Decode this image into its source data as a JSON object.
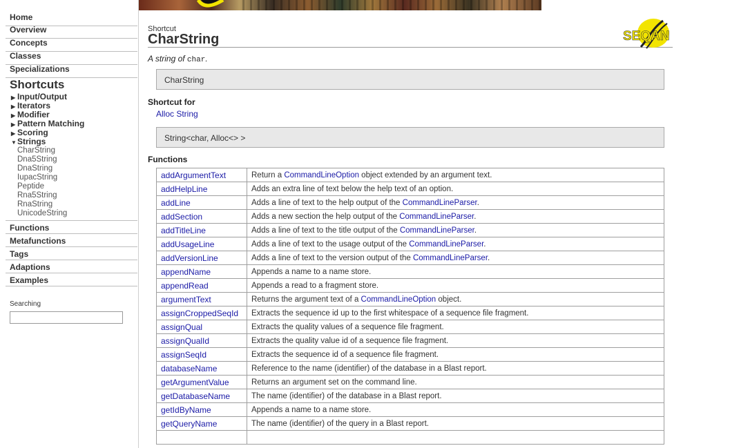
{
  "sidebar": {
    "nav": [
      "Home",
      "Overview",
      "Concepts",
      "Classes",
      "Specializations"
    ],
    "shortcuts_heading": "Shortcuts",
    "shortcut_groups": [
      {
        "label": "Input/Output",
        "expanded": false
      },
      {
        "label": "Iterators",
        "expanded": false
      },
      {
        "label": "Modifier",
        "expanded": false
      },
      {
        "label": "Pattern Matching",
        "expanded": false
      },
      {
        "label": "Scoring",
        "expanded": false
      },
      {
        "label": "Strings",
        "expanded": true
      }
    ],
    "string_items": [
      "CharString",
      "Dna5String",
      "DnaString",
      "IupacString",
      "Peptide",
      "Rna5String",
      "RnaString",
      "UnicodeString"
    ],
    "nav_after": [
      "Functions",
      "Metafunctions",
      "Tags",
      "Adaptions",
      "Examples"
    ],
    "search_label": "Searching",
    "search_value": ""
  },
  "page": {
    "kind": "Shortcut",
    "title": "CharString",
    "summary_prefix": "A string of",
    "summary_code": "char",
    "summary_suffix": ".",
    "signature": "CharString",
    "shortcut_for_heading": "Shortcut for",
    "shortcut_for_link": "Alloc String",
    "shortcut_for_code": "String<char, Alloc<> >",
    "functions_heading": "Functions",
    "logo_text": "SEQAN"
  },
  "functions": [
    {
      "name": "addArgumentText",
      "desc": [
        {
          "t": "Return a "
        },
        {
          "l": "CommandLineOption"
        },
        {
          "t": " object extended by an argument text."
        }
      ]
    },
    {
      "name": "addHelpLine",
      "desc": [
        {
          "t": "Adds an extra line of text below the help text of an option."
        }
      ]
    },
    {
      "name": "addLine",
      "desc": [
        {
          "t": "Adds a line of text to the help output of the "
        },
        {
          "l": "CommandLineParser"
        },
        {
          "t": "."
        }
      ]
    },
    {
      "name": "addSection",
      "desc": [
        {
          "t": "Adds a new section the help output of the "
        },
        {
          "l": "CommandLineParser"
        },
        {
          "t": "."
        }
      ]
    },
    {
      "name": "addTitleLine",
      "desc": [
        {
          "t": "Adds a line of text to the title output of the "
        },
        {
          "l": "CommandLineParser"
        },
        {
          "t": "."
        }
      ]
    },
    {
      "name": "addUsageLine",
      "desc": [
        {
          "t": "Adds a line of text to the usage output of the "
        },
        {
          "l": "CommandLineParser"
        },
        {
          "t": "."
        }
      ]
    },
    {
      "name": "addVersionLine",
      "desc": [
        {
          "t": "Adds a line of text to the version output of the "
        },
        {
          "l": "CommandLineParser"
        },
        {
          "t": "."
        }
      ]
    },
    {
      "name": "appendName",
      "desc": [
        {
          "t": "Appends a name to a name store."
        }
      ]
    },
    {
      "name": "appendRead",
      "desc": [
        {
          "t": "Appends a read to a fragment store."
        }
      ]
    },
    {
      "name": "argumentText",
      "desc": [
        {
          "t": "Returns the argument text of a "
        },
        {
          "l": "CommandLineOption"
        },
        {
          "t": " object."
        }
      ]
    },
    {
      "name": "assignCroppedSeqId",
      "desc": [
        {
          "t": "Extracts the sequence id up to the first whitespace of a sequence file fragment."
        }
      ]
    },
    {
      "name": "assignQual",
      "desc": [
        {
          "t": "Extracts the quality values of a sequence file fragment."
        }
      ]
    },
    {
      "name": "assignQualId",
      "desc": [
        {
          "t": "Extracts the quality value id of a sequence file fragment."
        }
      ]
    },
    {
      "name": "assignSeqId",
      "desc": [
        {
          "t": "Extracts the sequence id of a sequence file fragment."
        }
      ]
    },
    {
      "name": "databaseName",
      "desc": [
        {
          "t": "Reference to the name (identifier) of the database in a Blast report."
        }
      ]
    },
    {
      "name": "getArgumentValue",
      "desc": [
        {
          "t": "Returns an argument set on the command line."
        }
      ]
    },
    {
      "name": "getDatabaseName",
      "desc": [
        {
          "t": "The name (identifier) of the database in a Blast report."
        }
      ]
    },
    {
      "name": "getIdByName",
      "desc": [
        {
          "t": "Appends a name to a name store."
        }
      ]
    },
    {
      "name": "getQueryName",
      "desc": [
        {
          "t": "The name (identifier) of the query in a Blast report."
        }
      ]
    },
    {
      "name": "",
      "desc": [
        {
          "t": ""
        }
      ]
    }
  ],
  "colors": {
    "link": "#1a1aa6",
    "codebox": "#e8e8e8",
    "logo_yellow": "#f2e400"
  }
}
